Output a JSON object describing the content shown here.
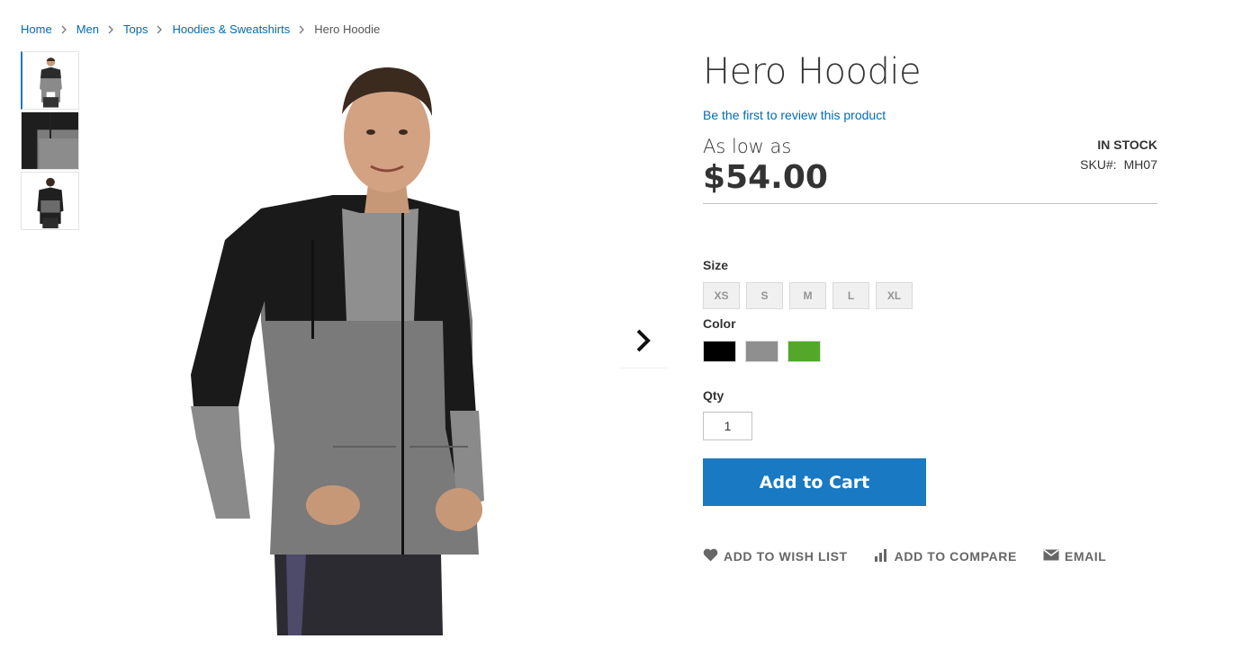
{
  "breadcrumbs": [
    {
      "label": "Home"
    },
    {
      "label": "Men"
    },
    {
      "label": "Tops"
    },
    {
      "label": "Hoodies & Sweatshirts"
    },
    {
      "label": "Hero Hoodie"
    }
  ],
  "gallery": {
    "thumbnails": [
      "front-view",
      "detail-view",
      "back-view"
    ],
    "active_index": 0,
    "next_icon": "chevron-right-icon"
  },
  "product": {
    "title": "Hero Hoodie",
    "review_link": "Be the first to review this product",
    "price_prefix": "As low as",
    "price": "$54.00",
    "stock": "IN STOCK",
    "sku_label": "SKU#:",
    "sku": "MH07"
  },
  "options": {
    "size_label": "Size",
    "sizes": [
      "XS",
      "S",
      "M",
      "L",
      "XL"
    ],
    "color_label": "Color",
    "colors": [
      {
        "name": "Black",
        "hex": "#000000"
      },
      {
        "name": "Gray",
        "hex": "#8f8f8f"
      },
      {
        "name": "Green",
        "hex": "#53a829"
      }
    ]
  },
  "qty": {
    "label": "Qty",
    "value": "1"
  },
  "cart": {
    "button_label": "Add to Cart",
    "accent": "#1979c3"
  },
  "actions": {
    "wishlist": "ADD TO WISH LIST",
    "compare": "ADD TO COMPARE",
    "email": "EMAIL"
  }
}
